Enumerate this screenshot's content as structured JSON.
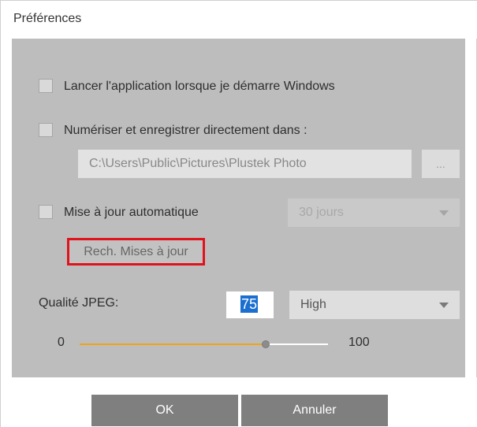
{
  "window": {
    "title": "Préférences"
  },
  "options": {
    "launch_on_startup": {
      "label": "Lancer l'application lorsque je démarre Windows",
      "checked": false
    },
    "scan_direct_save": {
      "label": "Numériser et enregistrer directement dans :",
      "checked": false,
      "path_value": "C:\\Users\\Public\\Pictures\\Plustek Photo",
      "browse_label": "..."
    },
    "auto_update": {
      "label": "Mise à jour automatique",
      "checked": false,
      "interval_selected": "30 jours",
      "check_updates_label": "Rech. Mises à jour"
    }
  },
  "jpeg": {
    "label": "Qualité JPEG:",
    "value": "75",
    "quality_selected": "High",
    "slider": {
      "min_label": "0",
      "max_label": "100",
      "fraction": 0.75
    }
  },
  "buttons": {
    "ok_label": "OK",
    "cancel_label": "Annuler"
  },
  "colors": {
    "highlight_border": "#e0121b",
    "slider_fill": "#f0a418",
    "selection": "#1a6fd0",
    "panel_background": "#bdbdbd"
  }
}
